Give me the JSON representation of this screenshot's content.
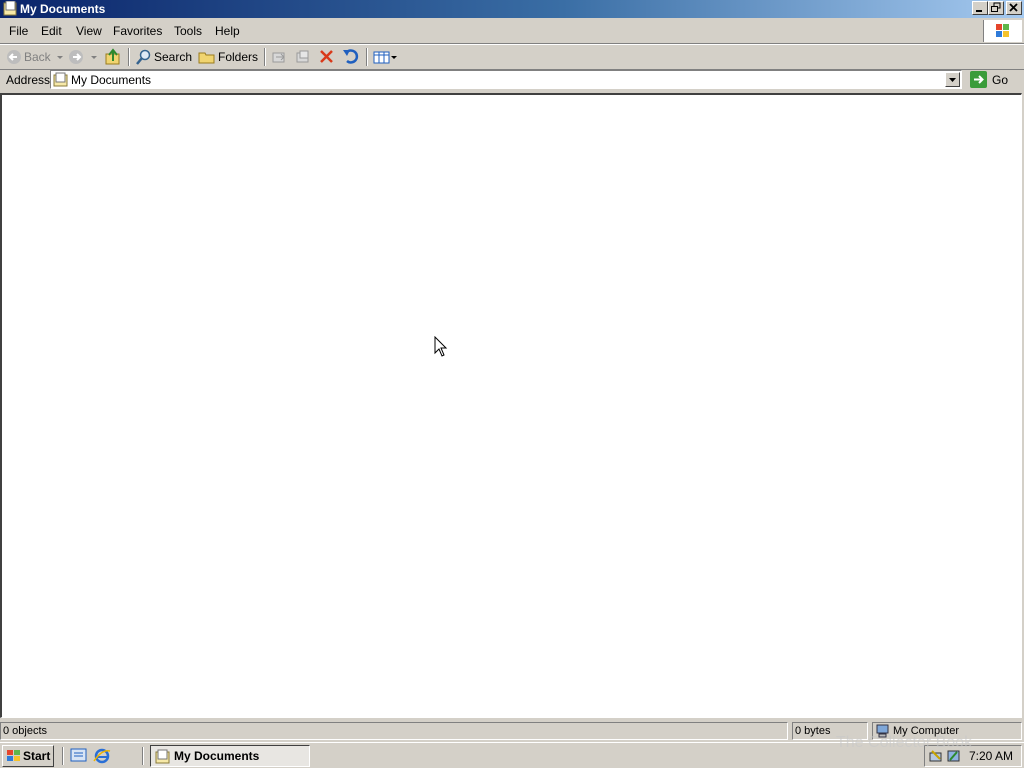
{
  "window": {
    "title": "My Documents",
    "colors": {
      "title_active": "#0a246a",
      "title_gradient_end": "#a6caf0",
      "face": "#d4d0c8"
    }
  },
  "menu": {
    "items": [
      "File",
      "Edit",
      "View",
      "Favorites",
      "Tools",
      "Help"
    ]
  },
  "toolbar": {
    "back_label": "Back",
    "search_label": "Search",
    "folders_label": "Folders"
  },
  "address": {
    "label": "Address",
    "value": "My Documents",
    "go_label": "Go"
  },
  "status": {
    "objects": "0 objects",
    "size": "0 bytes",
    "zone": "My Computer"
  },
  "taskbar": {
    "start_label": "Start",
    "task_label": "My Documents",
    "clock": "7:20 AM"
  },
  "watermark": "The Collector Book"
}
